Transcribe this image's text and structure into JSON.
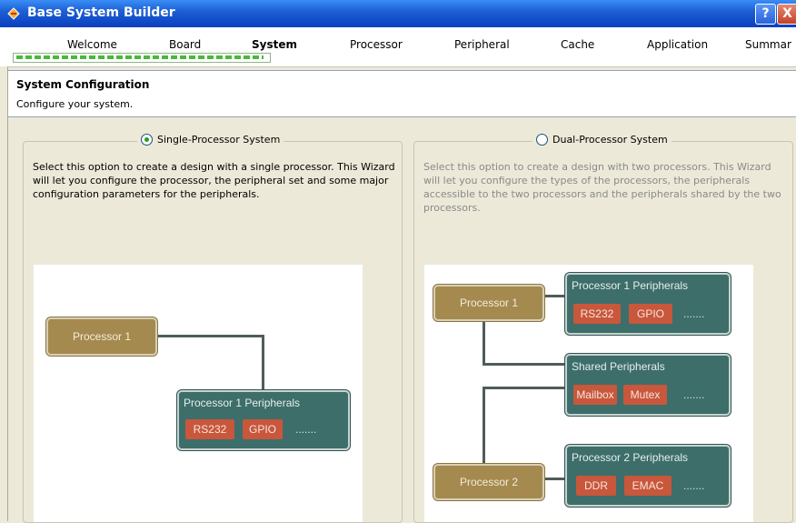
{
  "window": {
    "title": "Base System Builder",
    "help_btn": "?",
    "close_btn": "X"
  },
  "steps": [
    {
      "label": "Welcome"
    },
    {
      "label": "Board"
    },
    {
      "label": "System"
    },
    {
      "label": "Processor"
    },
    {
      "label": "Peripheral"
    },
    {
      "label": "Cache"
    },
    {
      "label": "Application"
    },
    {
      "label": "Summar"
    }
  ],
  "header": {
    "title": "System Configuration",
    "subtitle": "Configure your system."
  },
  "single": {
    "label": "Single-Processor System",
    "desc": "Select this option to create a design with a single processor. This Wizard will let you configure the processor, the peripheral set and some major configuration parameters for the peripherals.",
    "proc1": "Processor 1",
    "periph_title": "Processor 1 Peripherals",
    "chips": [
      "RS232",
      "GPIO"
    ],
    "dots": "......."
  },
  "dual": {
    "label": "Dual-Processor System",
    "desc": "Select this option to create a design with two processors. This Wizard will let you configure the types of the processors, the peripherals accessible to the two processors and the peripherals shared by the two processors.",
    "proc1": "Processor 1",
    "proc2": "Processor 2",
    "p1_title": "Processor 1 Peripherals",
    "p1_chips": [
      "RS232",
      "GPIO"
    ],
    "shared_title": "Shared Peripherals",
    "shared_chips": [
      "Mailbox",
      "Mutex"
    ],
    "p2_title": "Processor 2 Peripherals",
    "p2_chips": [
      "DDR",
      "EMAC"
    ],
    "dots": "......."
  }
}
